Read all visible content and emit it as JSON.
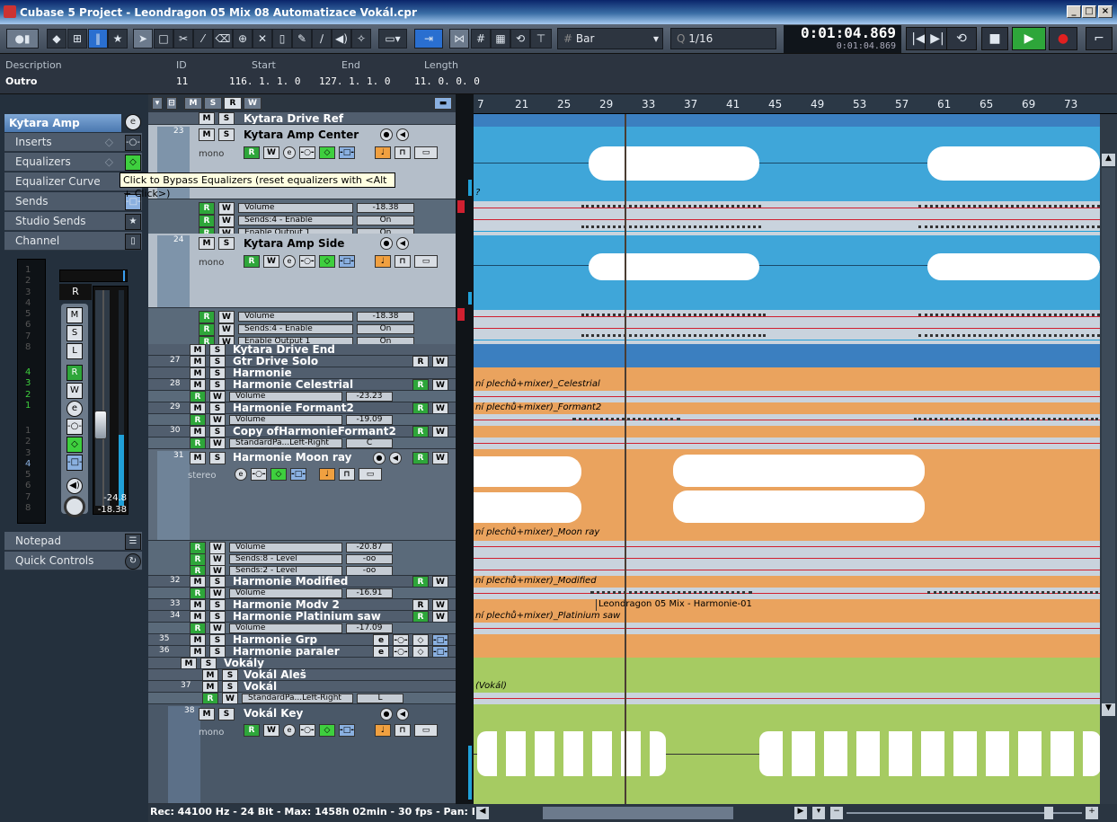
{
  "window": {
    "title": "Cubase 5 Project - Leondragon 05 Mix 08 Automatizace Vokál.cpr"
  },
  "toolbar": {
    "snap_type": "Bar",
    "quantize": "1/16"
  },
  "transport": {
    "time_primary": "0:01:04.869",
    "time_secondary": "0:01:04.869"
  },
  "infoline": {
    "headers": [
      "Description",
      "ID",
      "Start",
      "End",
      "Length"
    ],
    "values": [
      "Outro",
      "11",
      "116. 1. 1.   0",
      "127. 1. 1.   0",
      "11. 0. 0.   0"
    ]
  },
  "inspector": {
    "track_name": "Kytara Amp Center",
    "sections": [
      "Inserts",
      "Equalizers",
      "Equalizer Curve",
      "Sends",
      "Studio Sends",
      "Channel",
      "Notepad",
      "Quick Controls"
    ],
    "fader_letter": "R",
    "meter_value": "-24.8",
    "fader_value": "-18.38",
    "scale_top": [
      "1",
      "2",
      "3",
      "4",
      "5",
      "6",
      "7",
      "8"
    ],
    "scale_mid": [
      "4",
      "3",
      "2",
      "1"
    ],
    "scale_bot": [
      "1",
      "2",
      "3",
      "4",
      "5",
      "6",
      "7",
      "8"
    ]
  },
  "tooltip": {
    "text": "Click to Bypass Equalizers (reset equalizers with <Alt + Click>)"
  },
  "tracks": {
    "t_kde_ref": "Kytara Drive Ref",
    "t23_num": "23",
    "t23_name": "Kytara Amp Center",
    "t23_sub": "mono",
    "t23_p1": "Volume",
    "t23_v1": "-18.38",
    "t23_p2": "Sends:4 - Enable",
    "t23_v2": "On",
    "t23_p3": "Enable Output 1",
    "t23_v3": "On",
    "t24_num": "24",
    "t24_name": "Kytara Amp Side",
    "t24_sub": "mono",
    "t24_p1": "Volume",
    "t24_v1": "-18.38",
    "t24_p2": "Sends:4 - Enable",
    "t24_v2": "On",
    "t24_p3": "Enable Output 1",
    "t24_v3": "On",
    "t_kde_end": "Kytara Drive End",
    "t27_num": "27",
    "t27_name": "Gtr Drive Solo",
    "t_harm": "Harmonie",
    "t28_num": "28",
    "t28_name": "Harmonie Celestrial",
    "t28_p1": "Volume",
    "t28_v1": "-23.23",
    "t29_num": "29",
    "t29_name": "Harmonie Formant2",
    "t29_p1": "Volume",
    "t29_v1": "-19.09",
    "t30_num": "30",
    "t30_name": "Copy ofHarmonieFormant2",
    "t30_p1": "StandardPa...Left-Right",
    "t30_v1": "C",
    "t31_num": "31",
    "t31_name": "Harmonie Moon ray",
    "t31_sub": "stereo",
    "t31_p1": "Volume",
    "t31_v1": "-20.87",
    "t31_p2": "Sends:8 - Level",
    "t31_v2": "-oo",
    "t31_p3": "Sends:2 - Level",
    "t31_v3": "-oo",
    "t32_num": "32",
    "t32_name": "Harmonie Modified",
    "t32_p1": "Volume",
    "t32_v1": "-16.91",
    "t33_num": "33",
    "t33_name": "Harmonie Modv 2",
    "t34_num": "34",
    "t34_name": "Harmonie Platinium saw",
    "t34_p1": "Volume",
    "t34_v1": "-17.09",
    "t35_num": "35",
    "t35_name": "Harmonie Grp",
    "t36_num": "36",
    "t36_name": "Harmonie paraler",
    "t_vokaly": "Vokály",
    "t_vales": "Vokál Aleš",
    "t37_num": "37",
    "t37_name": "Vokál",
    "t37_p1": "StandardPa...Left-Right",
    "t37_v1": "L",
    "t38_num": "38",
    "t38_name": "Vokál Key",
    "t38_sub": "mono"
  },
  "ruler": [
    "7",
    "21",
    "25",
    "29",
    "33",
    "37",
    "41",
    "45",
    "49",
    "53",
    "57",
    "61",
    "65",
    "69",
    "73"
  ],
  "event_labels": {
    "celestrial": "ní plechů+mixer)_Celestrial",
    "formant2": "ní plechů+mixer)_Formant2",
    "moonray": "ní plechů+mixer)_Moon ray",
    "modified": "ní plechů+mixer)_Modified",
    "harmonie01": "Leondragon 05 Mix - Harmonie-01",
    "platinium": "ní plechů+mixer)_Platinium saw",
    "vokal": "(Vokál)",
    "q": "?"
  },
  "status": {
    "text": "Rec: 44100 Hz - 24 Bit - Max: 1458h 02min - 30 fps - Pan: Equa"
  },
  "colors": {
    "audio_blue": "#3fa6d9",
    "audio_orange": "#eaa35e",
    "audio_green": "#a6cb62",
    "automation_line": "#d02030"
  }
}
